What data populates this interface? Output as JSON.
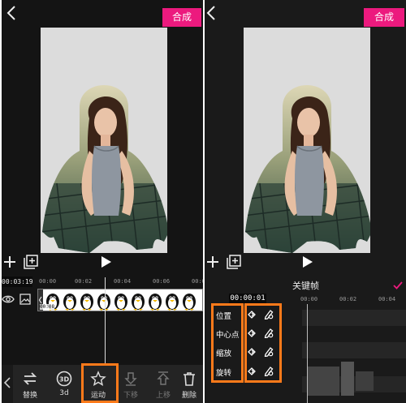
{
  "left": {
    "compose_label": "合成",
    "current_time": "00:03:19",
    "ruler_ticks": [
      "00:00",
      "00:02",
      "00:04",
      "00:06",
      "00:0"
    ],
    "strip_time": "00:08",
    "bottom_buttons": [
      {
        "label": "替换",
        "icon": "swap-icon"
      },
      {
        "label": "3d",
        "icon": "3d-icon"
      },
      {
        "label": "运动",
        "icon": "motion-star-icon"
      },
      {
        "label": "下移",
        "icon": "move-down-icon"
      },
      {
        "label": "上移",
        "icon": "move-up-icon"
      },
      {
        "label": "删除",
        "icon": "trash-icon"
      }
    ]
  },
  "right": {
    "compose_label": "合成",
    "keyframe_title": "关键帧",
    "current_time": "00:00:01",
    "ruler_ticks": [
      "00:00",
      "00:02",
      "00:04"
    ],
    "rows": [
      "位置",
      "中心点",
      "缩放",
      "旋转"
    ]
  },
  "colors": {
    "accent": "#ec1a7e",
    "highlight": "#ff7a1a",
    "panel_bg": "#141414"
  }
}
